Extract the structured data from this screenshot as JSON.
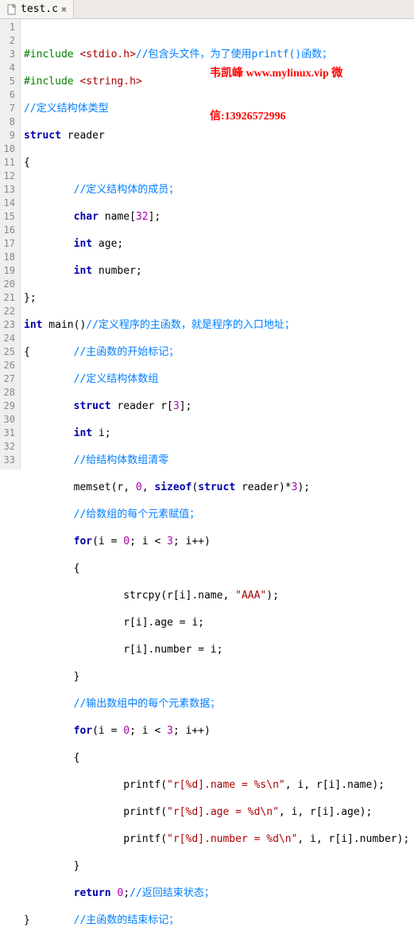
{
  "tab": {
    "filename": "test.c",
    "close_glyph": "✖"
  },
  "watermark": {
    "line1": "韦凯峰 www.mylinux.vip 微",
    "line2": "信:13926572996"
  },
  "code": {
    "l1": {
      "pp": "#include ",
      "inc": "<stdio.h>",
      "cmt": "//包含头文件，为了使用printf()函数；"
    },
    "l2": {
      "pp": "#include ",
      "inc": "<string.h>"
    },
    "l3": {
      "cmt": "//定义结构体类型"
    },
    "l4": {
      "kw": "struct",
      "txt": " reader"
    },
    "l5": {
      "txt": "{"
    },
    "l6": {
      "indent": "        ",
      "cmt": "//定义结构体的成员；"
    },
    "l7": {
      "indent": "        ",
      "kw": "char",
      "txt": " name[",
      "num": "32",
      "txt2": "];"
    },
    "l8": {
      "indent": "        ",
      "kw": "int",
      "txt": " age;"
    },
    "l9": {
      "indent": "        ",
      "kw": "int",
      "txt": " number;"
    },
    "l10": {
      "txt": "};"
    },
    "l11": {
      "kw": "int",
      "txt": " main()",
      "cmt": "//定义程序的主函数，就是程序的入口地址；"
    },
    "l12": {
      "txt": "{       ",
      "cmt": "//主函数的开始标记；"
    },
    "l13": {
      "indent": "        ",
      "cmt": "//定义结构体数组"
    },
    "l14": {
      "indent": "        ",
      "kw": "struct",
      "txt": " reader r[",
      "num": "3",
      "txt2": "];"
    },
    "l15": {
      "indent": "        ",
      "kw": "int",
      "txt": " i;"
    },
    "l16": {
      "indent": "        ",
      "cmt": "//给结构体数组清零"
    },
    "l17": {
      "indent": "        ",
      "txt": "memset(r, ",
      "num": "0",
      "txt2": ", ",
      "kw": "sizeof",
      "txt3": "(",
      "kw2": "struct",
      "txt4": " reader)*",
      "num2": "3",
      "txt5": ");"
    },
    "l18": {
      "indent": "        ",
      "cmt": "//给数组的每个元素赋值；"
    },
    "l19": {
      "indent": "        ",
      "kw": "for",
      "txt": "(i = ",
      "num": "0",
      "txt2": "; i < ",
      "num2": "3",
      "txt3": "; i++)"
    },
    "l20": {
      "indent": "        ",
      "txt": "{"
    },
    "l21": {
      "indent": "                ",
      "txt": "strcpy(r[i].name, ",
      "str": "\"AAA\"",
      "txt2": ");"
    },
    "l22": {
      "indent": "                ",
      "txt": "r[i].age = i;"
    },
    "l23": {
      "indent": "                ",
      "txt": "r[i].number = i;"
    },
    "l24": {
      "indent": "        ",
      "txt": "}"
    },
    "l25": {
      "indent": "        ",
      "cmt": "//输出数组中的每个元素数据；"
    },
    "l26": {
      "indent": "        ",
      "kw": "for",
      "txt": "(i = ",
      "num": "0",
      "txt2": "; i < ",
      "num2": "3",
      "txt3": "; i++)"
    },
    "l27": {
      "indent": "        ",
      "txt": "{"
    },
    "l28": {
      "indent": "                ",
      "txt": "printf(",
      "str": "\"r[%d].name = %s\\n\"",
      "txt2": ", i, r[i].name);"
    },
    "l29": {
      "indent": "                ",
      "txt": "printf(",
      "str": "\"r[%d].age = %d\\n\"",
      "txt2": ", i, r[i].age);"
    },
    "l30": {
      "indent": "                ",
      "txt": "printf(",
      "str": "\"r[%d].number = %d\\n\"",
      "txt2": ", i, r[i].number);"
    },
    "l31": {
      "indent": "        ",
      "txt": "}"
    },
    "l32": {
      "indent": "        ",
      "kw": "return",
      "txt": " ",
      "num": "0",
      "txt2": ";",
      "cmt": "//返回结束状态；"
    },
    "l33": {
      "txt": "}       ",
      "cmt": "//主函数的结束标记；"
    }
  },
  "line_count": 33
}
